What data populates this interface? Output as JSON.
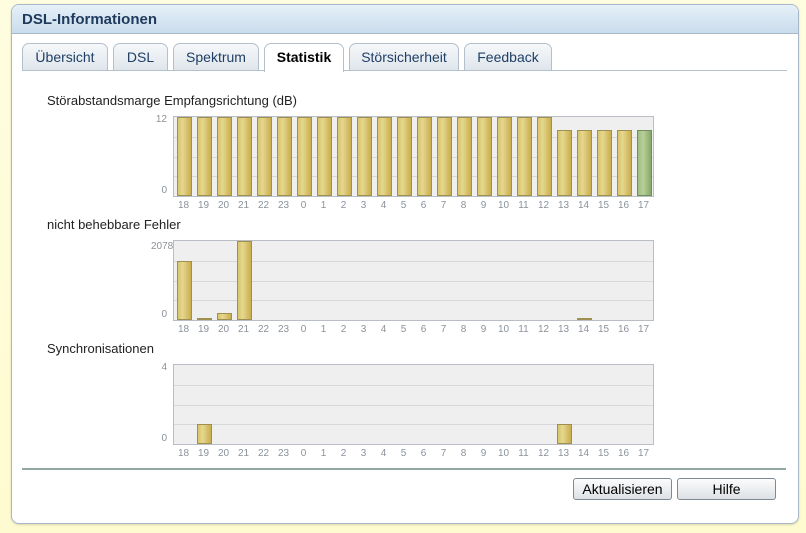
{
  "window": {
    "title": "DSL-Informationen"
  },
  "tabs": [
    {
      "label": "Übersicht"
    },
    {
      "label": "DSL"
    },
    {
      "label": "Spektrum"
    },
    {
      "label": "Statistik"
    },
    {
      "label": "Störsicherheit"
    },
    {
      "label": "Feedback"
    }
  ],
  "active_tab": "Statistik",
  "buttons": {
    "refresh": "Aktualisieren",
    "help": "Hilfe"
  },
  "chart_data": [
    {
      "type": "bar",
      "title": "Störabstandsmarge Empfangsrichtung (dB)",
      "categories": [
        "18",
        "19",
        "20",
        "21",
        "22",
        "23",
        "0",
        "1",
        "2",
        "3",
        "4",
        "5",
        "6",
        "7",
        "8",
        "9",
        "10",
        "11",
        "12",
        "13",
        "14",
        "15",
        "16",
        "17"
      ],
      "values": [
        12,
        12,
        12,
        12,
        12,
        12,
        12,
        12,
        12,
        12,
        12,
        12,
        12,
        12,
        12,
        12,
        12,
        12,
        12,
        10,
        10,
        10,
        10,
        10
      ],
      "ylim": [
        0,
        12
      ],
      "ytick_labels": [
        "12",
        "0"
      ],
      "highlight_last": true
    },
    {
      "type": "bar",
      "title": "nicht behebbare Fehler",
      "categories": [
        "18",
        "19",
        "20",
        "21",
        "22",
        "23",
        "0",
        "1",
        "2",
        "3",
        "4",
        "5",
        "6",
        "7",
        "8",
        "9",
        "10",
        "11",
        "12",
        "13",
        "14",
        "15",
        "16",
        "17"
      ],
      "values": [
        1550,
        20,
        180,
        2078,
        0,
        0,
        0,
        0,
        0,
        0,
        0,
        0,
        0,
        0,
        0,
        0,
        0,
        0,
        0,
        0,
        20,
        0,
        0,
        0
      ],
      "ylim": [
        0,
        2078
      ],
      "ytick_labels": [
        "2078",
        "0"
      ],
      "highlight_last": false
    },
    {
      "type": "bar",
      "title": "Synchronisationen",
      "categories": [
        "18",
        "19",
        "20",
        "21",
        "22",
        "23",
        "0",
        "1",
        "2",
        "3",
        "4",
        "5",
        "6",
        "7",
        "8",
        "9",
        "10",
        "11",
        "12",
        "13",
        "14",
        "15",
        "16",
        "17"
      ],
      "values": [
        0,
        1,
        0,
        0,
        0,
        0,
        0,
        0,
        0,
        0,
        0,
        0,
        0,
        0,
        0,
        0,
        0,
        0,
        0,
        1,
        0,
        0,
        0,
        0
      ],
      "ylim": [
        0,
        4
      ],
      "ytick_labels": [
        "4",
        "0"
      ],
      "highlight_last": false
    }
  ]
}
